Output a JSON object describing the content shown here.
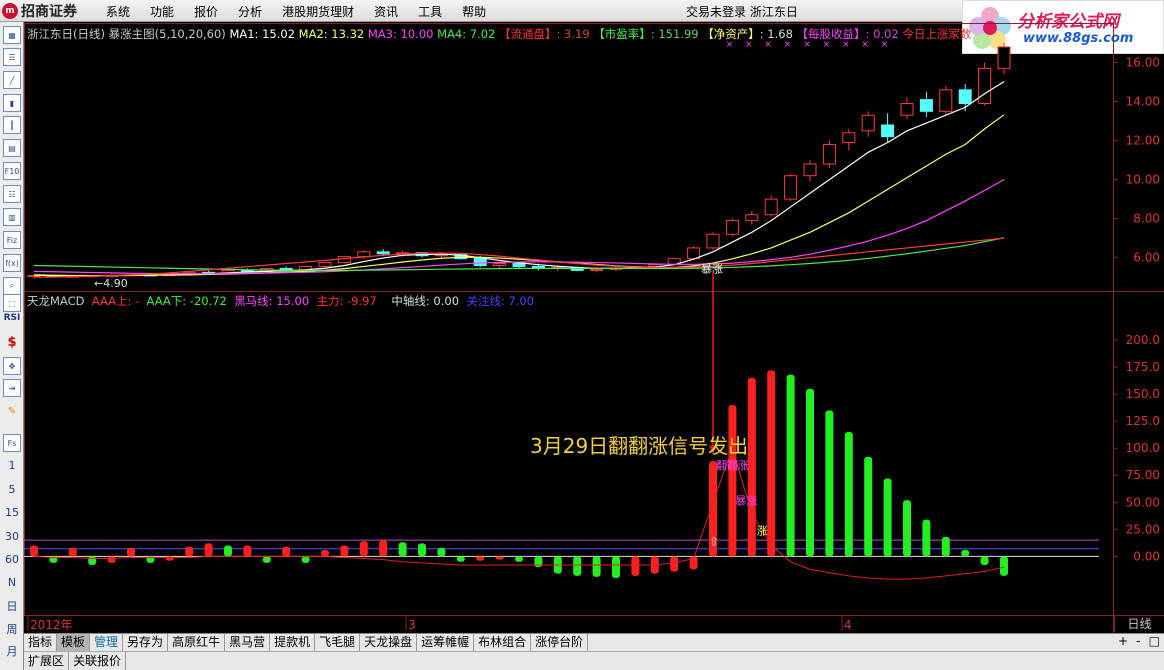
{
  "menu": {
    "logo": "招商证券",
    "logo_mark": "m",
    "items": [
      "系统",
      "功能",
      "报价",
      "分析",
      "港股期货理财",
      "资讯",
      "工具",
      "帮助"
    ],
    "status": "交易未登录  浙江东日"
  },
  "brand": {
    "title": "分析家公式网",
    "url": "www.88gs.com"
  },
  "toolbar": {
    "icons": [
      "grid-icon",
      "list-icon",
      "line-chart-icon",
      "bar-chart-icon",
      "candle-icon",
      "doc-icon",
      "f10-icon",
      "notes-icon",
      "report-icon",
      "fiz-icon",
      "f10-alt-icon",
      "search-icon",
      "screen-icon",
      "rsi-icon",
      "dollar-icon",
      "move-icon",
      "export-icon",
      "pen-icon",
      "fs-icon"
    ],
    "periods": [
      "1",
      "5",
      "15",
      "30",
      "60",
      "N",
      "日",
      "周",
      "月"
    ]
  },
  "main_header": {
    "stock": "浙江东日(日线)",
    "indicator": "暴涨主图(5,10,20,60)",
    "ma1": "MA1: 15.02",
    "ma2": "MA2: 13.32",
    "ma3": "MA3: 10.00",
    "ma4": "MA4: 7.02",
    "float_label": "【流通盘】",
    "float_val": ": 3.19",
    "pe_label": "【市盈率】",
    "pe_val": ": 151.99",
    "nav_label": "【净资产】",
    "nav_val": ": 1.68",
    "eps_label": "【每股收益】",
    "eps_val": ": 0.02",
    "today": "今日上涨家数"
  },
  "sub_header": {
    "name": "天龙MACD",
    "aaa_up": "AAA上: -",
    "aaa_down": "AAA下: -20.72",
    "hm": "黑马线: 15.00",
    "zl": "主力: -9.97",
    "mid": "中轴线: 0.00",
    "focus": "关注线: 7.00"
  },
  "annotation": "3月29日翻翻涨信号发出",
  "chart_data": [
    {
      "type": "line",
      "title": "暴涨主图(5,10,20,60)",
      "y_ticks": [
        "16.00",
        "14.00",
        "12.00",
        "10.00",
        "8.00",
        "6.00"
      ],
      "ylim": [
        4.6,
        17
      ],
      "low_label": "←4.90",
      "signal_label": "暴涨",
      "candles": [
        [
          5.05,
          5.1,
          4.95,
          5.08
        ],
        [
          5.08,
          5.12,
          5.0,
          5.02
        ],
        [
          5.02,
          5.08,
          4.98,
          5.05
        ],
        [
          5.05,
          5.1,
          5.0,
          5.08
        ],
        [
          5.08,
          5.15,
          5.02,
          5.1
        ],
        [
          5.1,
          5.18,
          5.05,
          5.12
        ],
        [
          5.12,
          5.15,
          5.05,
          5.08
        ],
        [
          5.08,
          5.2,
          5.05,
          5.18
        ],
        [
          5.18,
          5.3,
          5.1,
          5.25
        ],
        [
          5.25,
          5.35,
          5.15,
          5.2
        ],
        [
          5.2,
          5.4,
          5.15,
          5.35
        ],
        [
          5.35,
          5.45,
          5.25,
          5.3
        ],
        [
          5.3,
          5.5,
          5.28,
          5.45
        ],
        [
          5.45,
          5.55,
          5.3,
          5.35
        ],
        [
          5.35,
          5.6,
          5.3,
          5.55
        ],
        [
          5.55,
          5.8,
          5.5,
          5.75
        ],
        [
          5.75,
          6.1,
          5.7,
          6.05
        ],
        [
          6.05,
          6.4,
          5.95,
          6.3
        ],
        [
          6.3,
          6.45,
          6.1,
          6.2
        ],
        [
          6.2,
          6.35,
          6.05,
          6.25
        ],
        [
          6.25,
          6.3,
          6.0,
          6.1
        ],
        [
          6.1,
          6.25,
          5.95,
          6.15
        ],
        [
          6.15,
          6.2,
          5.9,
          5.95
        ],
        [
          6.0,
          6.1,
          5.5,
          5.6
        ],
        [
          5.6,
          5.8,
          5.4,
          5.7
        ],
        [
          5.7,
          5.75,
          5.45,
          5.55
        ],
        [
          5.55,
          5.7,
          5.35,
          5.45
        ],
        [
          5.45,
          5.6,
          5.3,
          5.5
        ],
        [
          5.5,
          5.55,
          5.3,
          5.35
        ],
        [
          5.35,
          5.5,
          5.25,
          5.4
        ],
        [
          5.4,
          5.55,
          5.3,
          5.45
        ],
        [
          5.45,
          5.6,
          5.4,
          5.55
        ],
        [
          5.55,
          5.7,
          5.45,
          5.65
        ],
        [
          5.65,
          6.0,
          5.6,
          5.95
        ],
        [
          5.95,
          6.6,
          5.9,
          6.5
        ],
        [
          6.5,
          7.3,
          6.4,
          7.2
        ],
        [
          7.2,
          8.0,
          7.1,
          7.9
        ],
        [
          7.9,
          8.4,
          7.7,
          8.2
        ],
        [
          8.2,
          9.2,
          8.1,
          9.0
        ],
        [
          9.0,
          10.3,
          8.9,
          10.2
        ],
        [
          10.2,
          11.0,
          9.9,
          10.8
        ],
        [
          10.8,
          12.0,
          10.6,
          11.8
        ],
        [
          11.9,
          12.6,
          11.5,
          12.4
        ],
        [
          12.5,
          13.5,
          12.2,
          13.3
        ],
        [
          12.8,
          13.4,
          11.9,
          12.2
        ],
        [
          13.3,
          14.2,
          13.1,
          13.9
        ],
        [
          14.1,
          14.5,
          13.2,
          13.5
        ],
        [
          13.5,
          14.8,
          13.3,
          14.6
        ],
        [
          14.6,
          14.9,
          13.5,
          13.9
        ],
        [
          13.9,
          16.0,
          13.8,
          15.7
        ],
        [
          15.7,
          17.0,
          15.4,
          16.8
        ]
      ],
      "series": [
        {
          "name": "MA1",
          "color": "#ffffff",
          "values": [
            5.1,
            5.08,
            5.06,
            5.06,
            5.08,
            5.1,
            5.11,
            5.12,
            5.15,
            5.18,
            5.22,
            5.27,
            5.3,
            5.34,
            5.38,
            5.46,
            5.6,
            5.8,
            5.98,
            6.12,
            6.16,
            6.18,
            6.13,
            6.0,
            5.86,
            5.74,
            5.64,
            5.56,
            5.5,
            5.45,
            5.45,
            5.48,
            5.52,
            5.64,
            5.92,
            6.3,
            6.8,
            7.3,
            7.9,
            8.6,
            9.3,
            10.0,
            10.7,
            11.4,
            11.9,
            12.5,
            12.9,
            13.3,
            13.7,
            14.4,
            15.02
          ]
        },
        {
          "name": "MA2",
          "color": "#ffff66",
          "values": [
            5.12,
            5.1,
            5.09,
            5.08,
            5.08,
            5.09,
            5.1,
            5.11,
            5.12,
            5.14,
            5.16,
            5.19,
            5.22,
            5.26,
            5.3,
            5.36,
            5.44,
            5.55,
            5.66,
            5.78,
            5.88,
            5.97,
            6.02,
            6.02,
            5.98,
            5.92,
            5.86,
            5.79,
            5.72,
            5.65,
            5.58,
            5.53,
            5.5,
            5.5,
            5.58,
            5.72,
            5.94,
            6.2,
            6.5,
            6.9,
            7.3,
            7.8,
            8.3,
            8.9,
            9.5,
            10.1,
            10.7,
            11.3,
            11.8,
            12.6,
            13.32
          ]
        },
        {
          "name": "MA3",
          "color": "#ff44ff",
          "values": [
            5.3,
            5.28,
            5.26,
            5.24,
            5.22,
            5.2,
            5.19,
            5.18,
            5.18,
            5.18,
            5.19,
            5.2,
            5.21,
            5.23,
            5.25,
            5.28,
            5.32,
            5.37,
            5.43,
            5.49,
            5.55,
            5.62,
            5.68,
            5.73,
            5.76,
            5.78,
            5.79,
            5.78,
            5.77,
            5.75,
            5.73,
            5.7,
            5.68,
            5.66,
            5.66,
            5.68,
            5.72,
            5.8,
            5.9,
            6.02,
            6.18,
            6.38,
            6.6,
            6.85,
            7.15,
            7.5,
            7.9,
            8.4,
            8.9,
            9.45,
            10.0
          ]
        },
        {
          "name": "MA4",
          "color": "#44ee44",
          "values": [
            5.6,
            5.58,
            5.56,
            5.54,
            5.52,
            5.5,
            5.48,
            5.46,
            5.44,
            5.42,
            5.4,
            5.38,
            5.37,
            5.36,
            5.35,
            5.35,
            5.35,
            5.36,
            5.37,
            5.38,
            5.39,
            5.41,
            5.42,
            5.43,
            5.44,
            5.45,
            5.45,
            5.45,
            5.45,
            5.45,
            5.45,
            5.45,
            5.45,
            5.45,
            5.46,
            5.48,
            5.5,
            5.54,
            5.58,
            5.64,
            5.7,
            5.78,
            5.86,
            5.96,
            6.08,
            6.2,
            6.34,
            6.48,
            6.62,
            6.82,
            7.02
          ]
        },
        {
          "name": "MA-red",
          "color": "#ff3a3a",
          "values": [
            5.0,
            5.01,
            5.03,
            5.05,
            5.08,
            5.12,
            5.16,
            5.22,
            5.3,
            5.38,
            5.46,
            5.54,
            5.62,
            5.7,
            5.78,
            5.86,
            5.95,
            6.04,
            6.12,
            6.18,
            6.22,
            6.24,
            6.22,
            6.16,
            6.08,
            5.98,
            5.88,
            5.78,
            5.7,
            5.62,
            5.56,
            5.52,
            5.5,
            5.5,
            5.52,
            5.56,
            5.62,
            5.7,
            5.8,
            5.9,
            6.0,
            6.1,
            6.2,
            6.3,
            6.4,
            6.5,
            6.6,
            6.7,
            6.8,
            6.9,
            7.0
          ]
        }
      ]
    },
    {
      "type": "bar",
      "title": "天龙MACD",
      "y_ticks": [
        "200.0",
        "175.0",
        "150.0",
        "125.0",
        "100.0",
        "75.00",
        "50.00",
        "25.00",
        "0.00"
      ],
      "ylim": [
        -20,
        225
      ],
      "hline_heima": 15,
      "hline_focus": 7,
      "values": [
        10,
        -6,
        8,
        -8,
        -6,
        8,
        -6,
        -4,
        9,
        12,
        10,
        10,
        -6,
        9,
        -6,
        6,
        10,
        14,
        15,
        13,
        12,
        8,
        -5,
        -4,
        -3,
        -5,
        -10,
        -16,
        -18,
        -19,
        -20,
        -18,
        -16,
        -14,
        -12,
        88,
        140,
        165,
        172,
        168,
        155,
        135,
        115,
        92,
        72,
        52,
        34,
        18,
        6,
        -8,
        -18
      ],
      "colors": "red if rising, green if falling",
      "zl_curve": [
        0,
        -1,
        -1,
        -2,
        -2,
        -1,
        -1,
        -1,
        -1,
        0,
        0,
        0,
        0,
        0,
        0,
        0,
        -1,
        -2,
        -3,
        -5,
        -6,
        -7,
        -8,
        -8,
        -8,
        -8,
        -8,
        -8,
        -8,
        -8,
        -8,
        -8,
        -8,
        -6,
        -2,
        50,
        100,
        40,
        10,
        -5,
        -12,
        -15,
        -18,
        -20,
        -21,
        -21,
        -20,
        -18,
        -16,
        -14,
        -10
      ],
      "labels": [
        "翻翻涨",
        "暴涨",
        "涨"
      ]
    }
  ],
  "x_axis": {
    "year": "2012年",
    "mar": "3",
    "apr": "4",
    "period": "日线"
  },
  "bottom_tabs": [
    "指标",
    "模板",
    "管理",
    "另存为",
    "高原红牛",
    "黑马营",
    "提款机",
    "飞毛腿",
    "天龙操盘",
    "运筹帷幄",
    "布林组合",
    "涨停台阶"
  ],
  "bottom_tabs_active": 1,
  "bottom_tabs_blue": 2,
  "bottom_row2": [
    "扩展区",
    "关联报价"
  ],
  "pm": [
    "+",
    "-",
    "□"
  ]
}
